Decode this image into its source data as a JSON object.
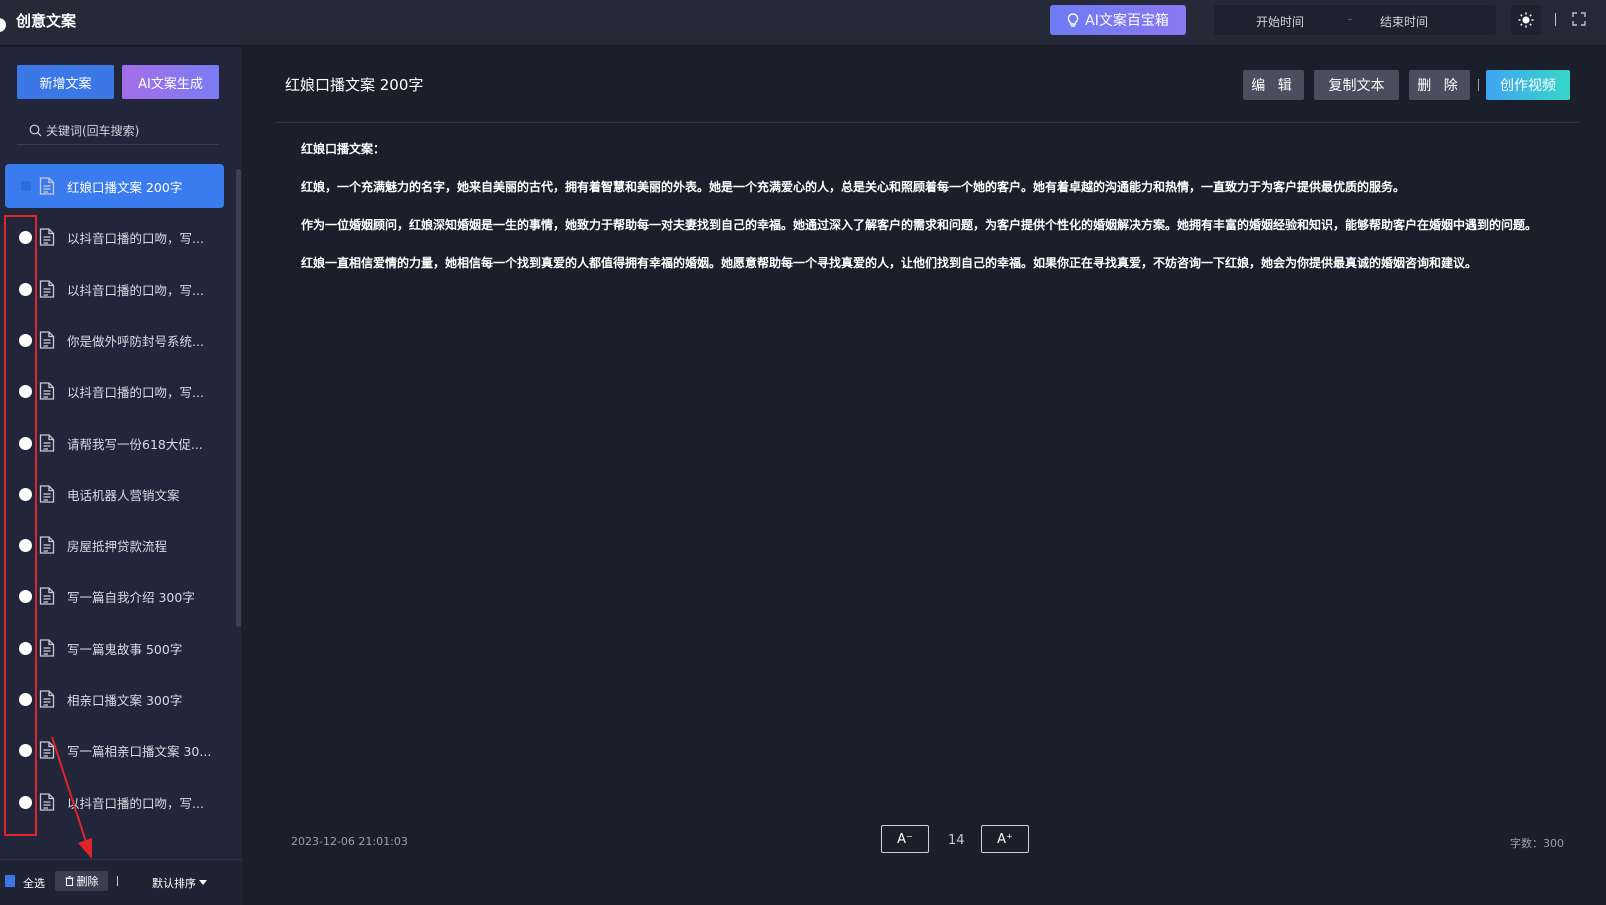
{
  "app": {
    "title": "创意文案"
  },
  "header": {
    "treasure_label": "AI文案百宝箱",
    "date_start": "开始时间",
    "date_sep": "-",
    "date_end": "结束时间"
  },
  "sidebar": {
    "new_label": "新增文案",
    "ai_label": "AI文案生成",
    "search_placeholder": "关键词(回车搜索)",
    "items": [
      {
        "label": "红娘口播文案 200字",
        "active": true
      },
      {
        "label": "以抖音口播的口吻，写..."
      },
      {
        "label": "以抖音口播的口吻，写..."
      },
      {
        "label": "你是做外呼防封号系统..."
      },
      {
        "label": "以抖音口播的口吻，写..."
      },
      {
        "label": "请帮我写一份618大促..."
      },
      {
        "label": "电话机器人营销文案"
      },
      {
        "label": "房屋抵押贷款流程"
      },
      {
        "label": "写一篇自我介绍 300字"
      },
      {
        "label": "写一篇鬼故事 500字"
      },
      {
        "label": "相亲口播文案 300字"
      },
      {
        "label": "写一篇相亲口播文案 30..."
      },
      {
        "label": "以抖音口播的口吻，写..."
      }
    ],
    "footer": {
      "select_all": "全选",
      "delete": "删除",
      "sort": "默认排序"
    }
  },
  "main": {
    "title": "红娘口播文案 200字",
    "actions": {
      "edit": "编 辑",
      "copy": "复制文本",
      "delete": "删 除",
      "video": "创作视频"
    },
    "paragraphs": [
      "红娘口播文案：",
      "红娘，一个充满魅力的名字，她来自美丽的古代，拥有着智慧和美丽的外表。她是一个充满爱心的人，总是关心和照顾着每一个她的客户。她有着卓越的沟通能力和热情，一直致力于为客户提供最优质的服务。",
      "作为一位婚姻顾问，红娘深知婚姻是一生的事情，她致力于帮助每一对夫妻找到自己的幸福。她通过深入了解客户的需求和问题，为客户提供个性化的婚姻解决方案。她拥有丰富的婚姻经验和知识，能够帮助客户在婚姻中遇到的问题。",
      "红娘一直相信爱情的力量，她相信每一个找到真爱的人都值得拥有幸福的婚姻。她愿意帮助每一个寻找真爱的人，让他们找到自己的幸福。如果你正在寻找真爱，不妨咨询一下红娘，她会为你提供最真诚的婚姻咨询和建议。"
    ],
    "footer": {
      "timestamp": "2023-12-06 21:01:03",
      "font_minus": "A⁻",
      "font_size": "14",
      "font_plus": "A⁺",
      "word_count": "字数：300"
    }
  },
  "colors": {
    "accent": "#3b7bf0",
    "annotation": "#e0242a"
  }
}
